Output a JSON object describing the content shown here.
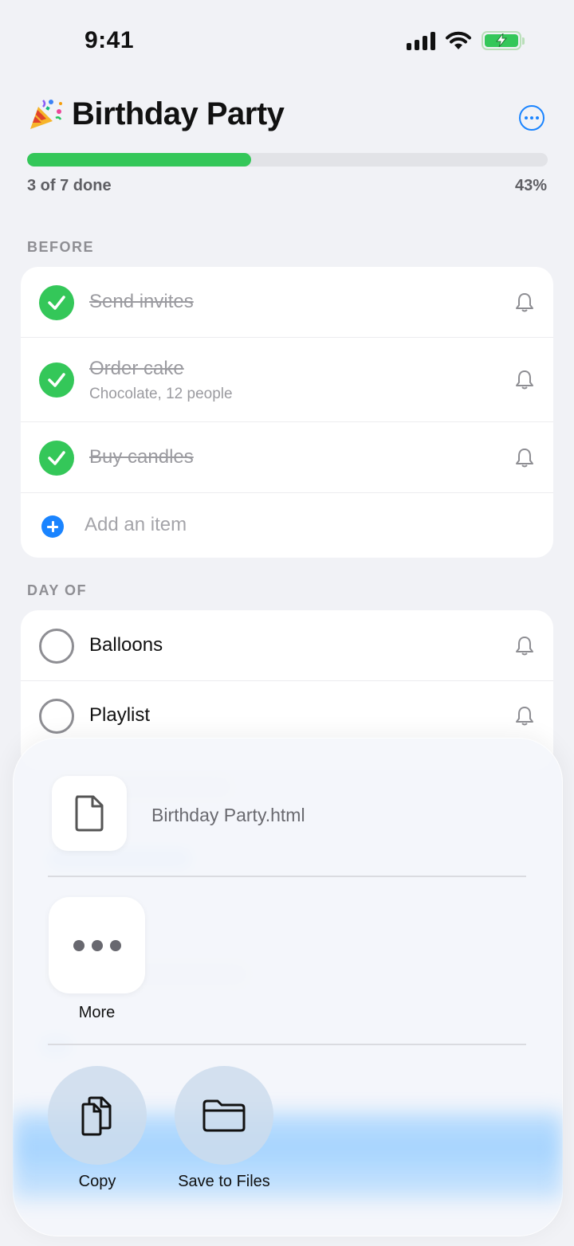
{
  "status_bar": {
    "time": "9:41"
  },
  "header": {
    "emoji": "🎉",
    "title": "Birthday Party",
    "progress_fraction": 0.43,
    "progress_text": "3 of 7 done",
    "progress_percent": "43%"
  },
  "sections": [
    {
      "title": "BEFORE",
      "items": [
        {
          "title": "Send invites",
          "note": "",
          "done": true
        },
        {
          "title": "Order cake",
          "note": "Chocolate, 12 people",
          "done": true
        },
        {
          "title": "Buy candles",
          "note": "",
          "done": true
        }
      ],
      "add_label": "Add an item"
    },
    {
      "title": "DAY OF",
      "items": [
        {
          "title": "Balloons",
          "note": "",
          "done": false
        },
        {
          "title": "Playlist",
          "note": "",
          "done": false
        }
      ]
    }
  ],
  "share_sheet": {
    "file_name": "Birthday Party.html",
    "more_label": "More",
    "actions": [
      {
        "label": "Copy",
        "icon": "copy-icon"
      },
      {
        "label": "Save to Files",
        "icon": "folder-icon"
      }
    ]
  },
  "colors": {
    "accent": "#1a84ff",
    "done_green": "#34c759",
    "background": "#f1f2f6"
  }
}
